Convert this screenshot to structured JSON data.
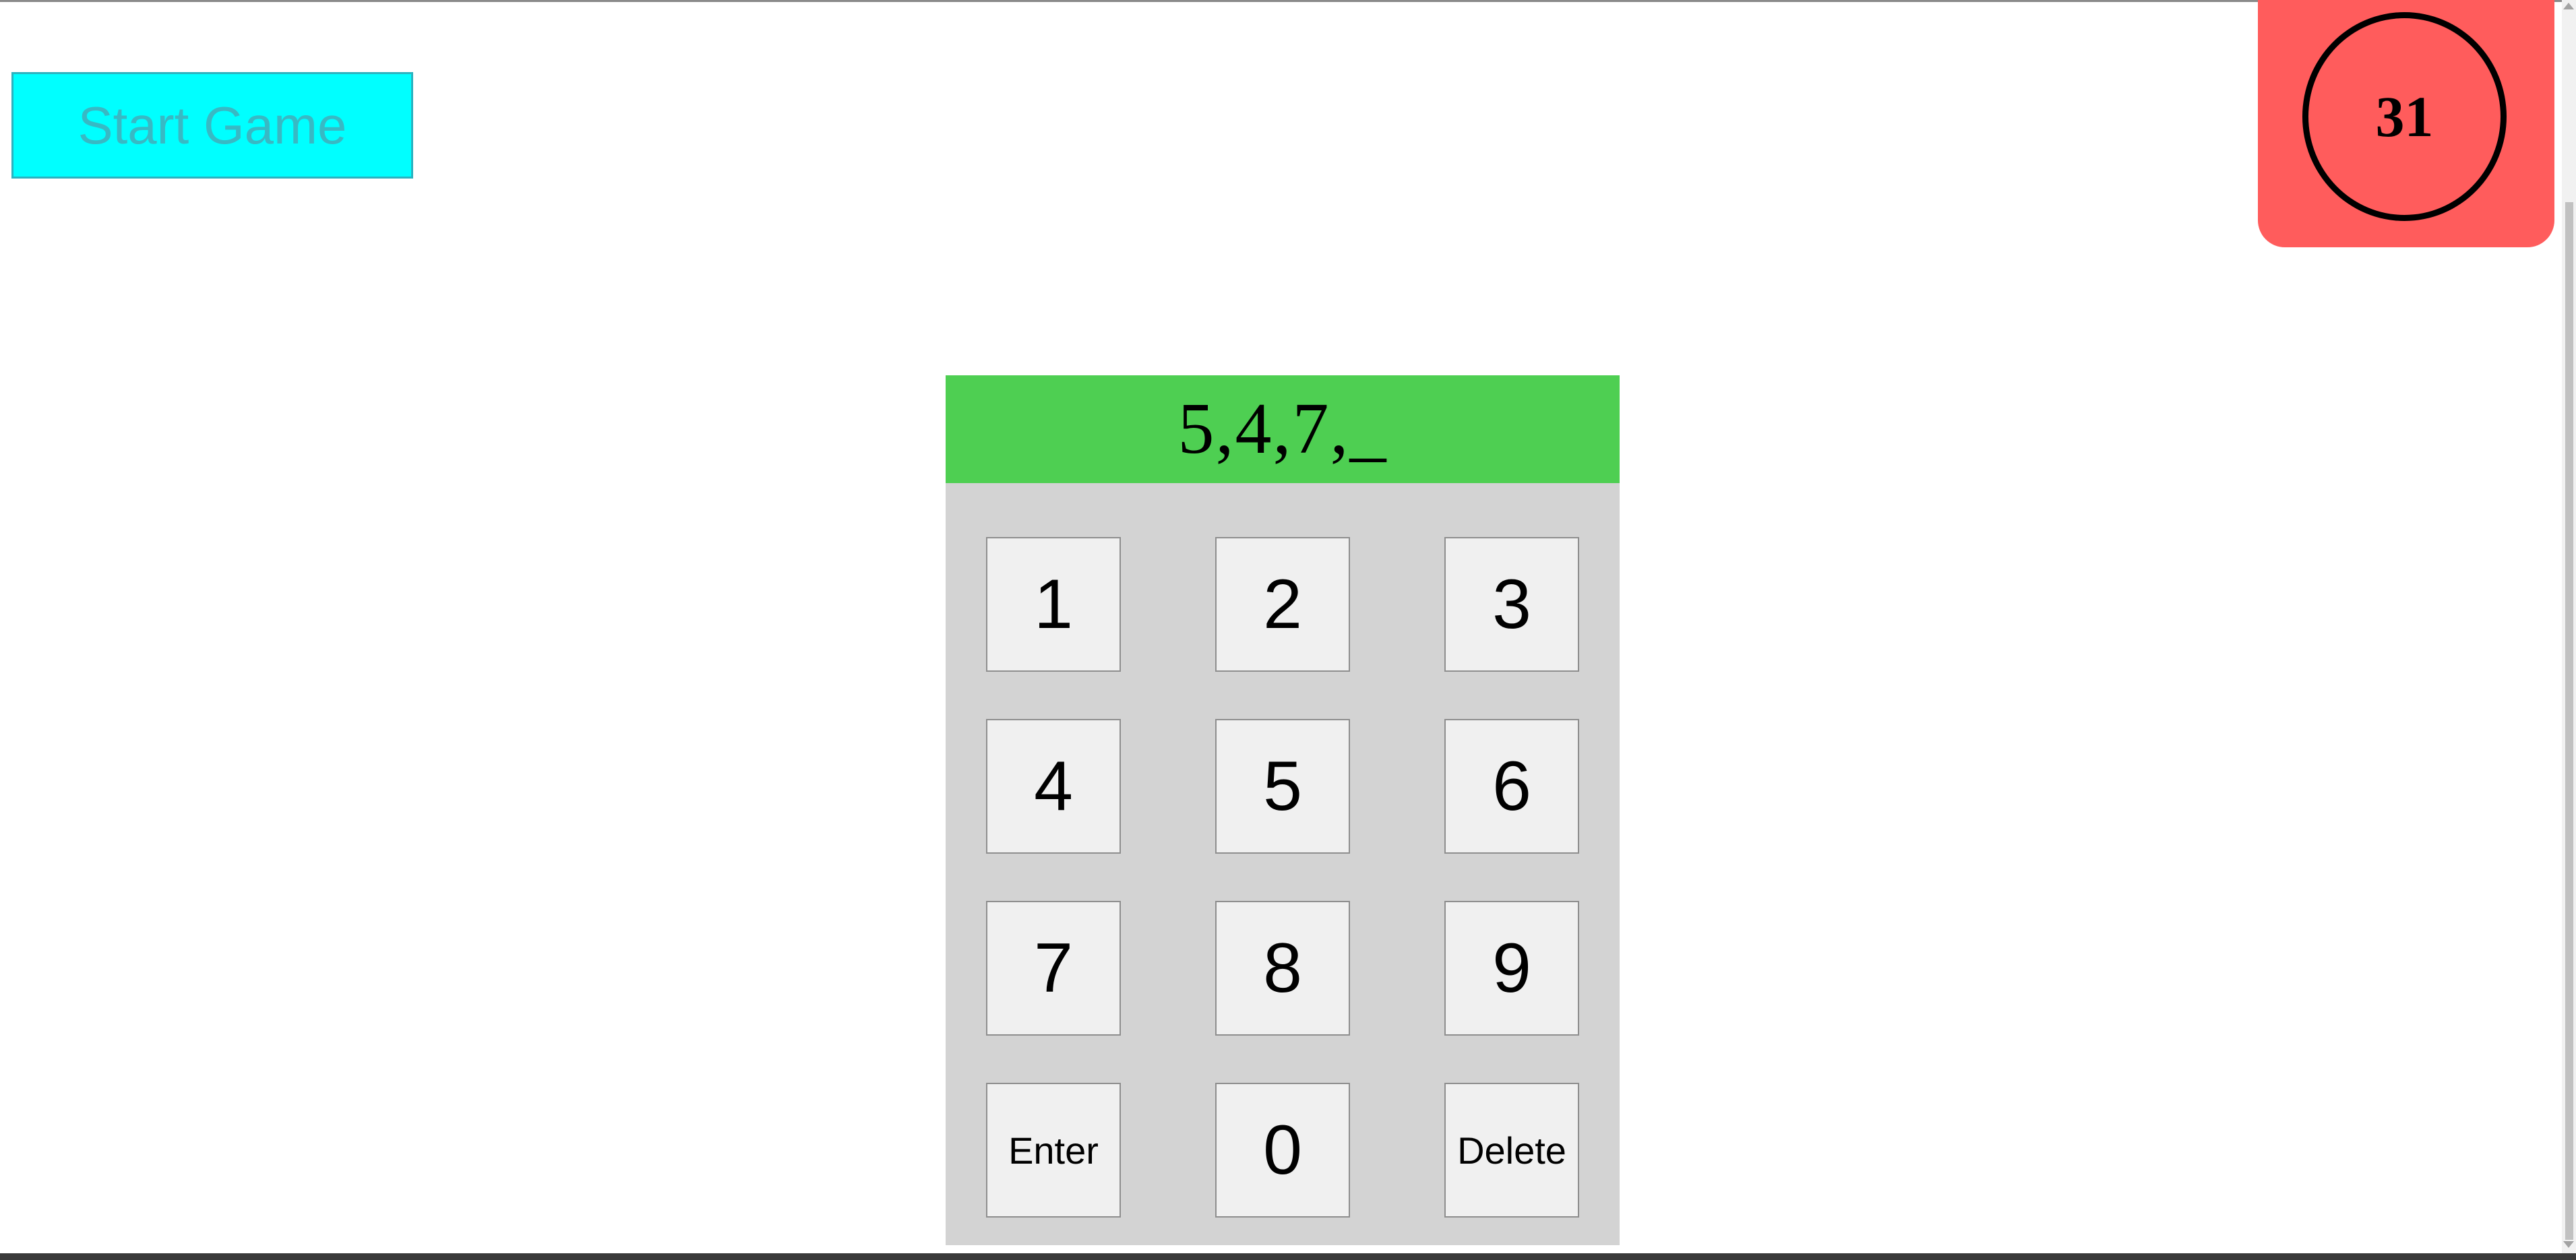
{
  "start_button": {
    "label": "Start Game"
  },
  "timer": {
    "value": "31"
  },
  "keypad": {
    "display": "5,4,7,_",
    "keys": {
      "k1": "1",
      "k2": "2",
      "k3": "3",
      "k4": "4",
      "k5": "5",
      "k6": "6",
      "k7": "7",
      "k8": "8",
      "k9": "9",
      "enter": "Enter",
      "k0": "0",
      "delete": "Delete"
    }
  },
  "colors": {
    "start_button_bg": "#00ffff",
    "timer_bg": "#ff5c5c",
    "display_bg": "#4ecf52",
    "keypad_bg": "#d3d3d3",
    "key_bg": "#f0f0f0"
  }
}
